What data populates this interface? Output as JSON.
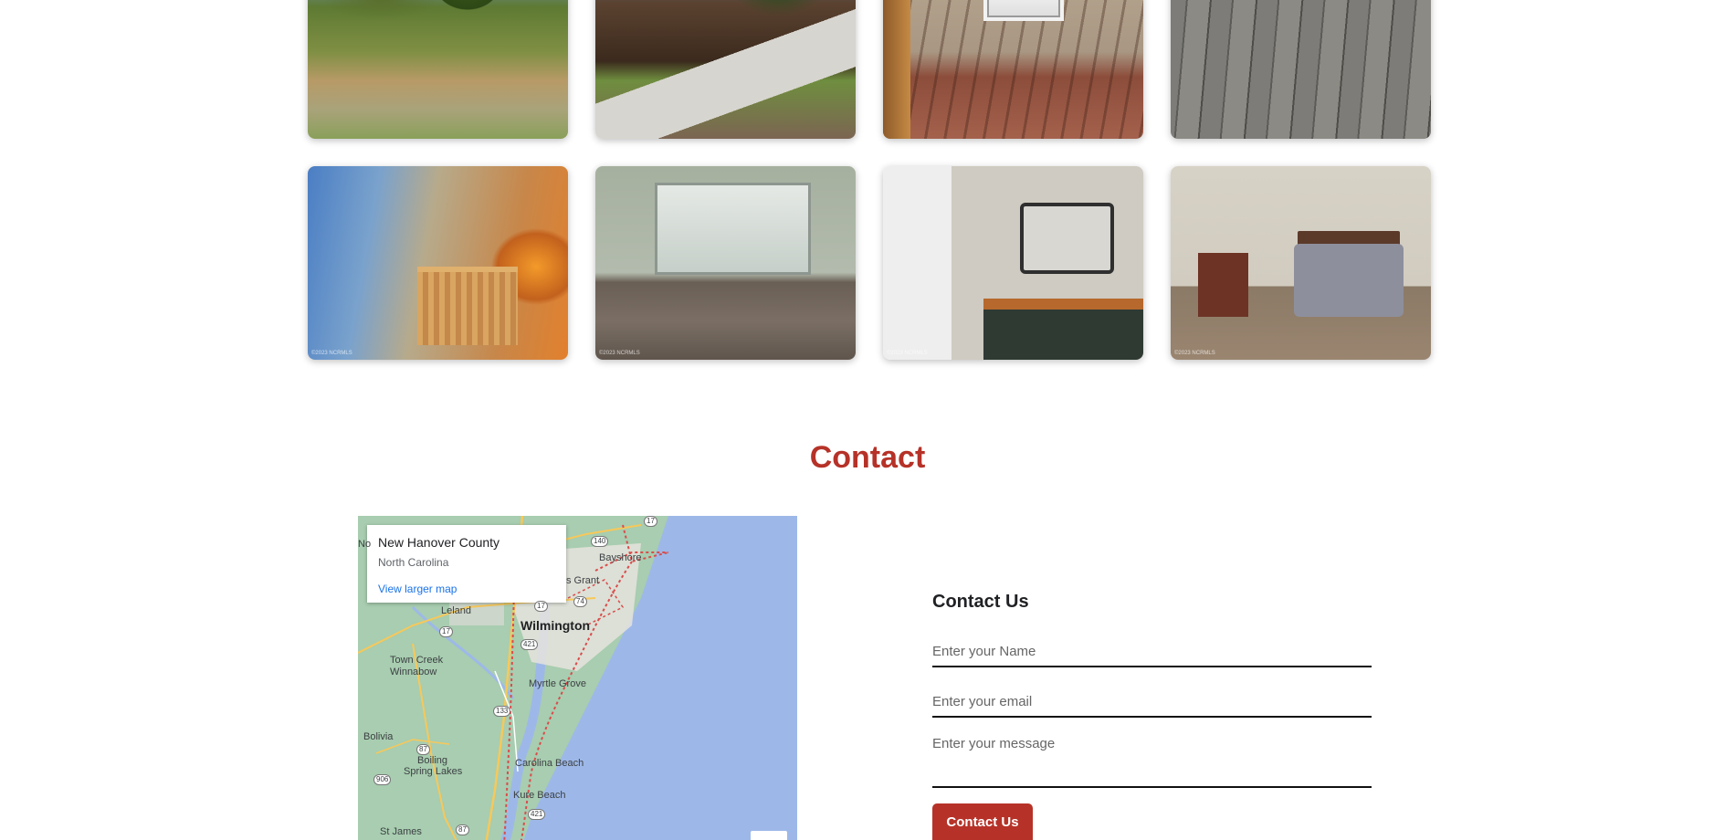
{
  "gallery": {
    "watermark": "©2023 NCRMLS"
  },
  "contact": {
    "section_title": "Contact",
    "form": {
      "title": "Contact Us",
      "name_placeholder": "Enter your Name",
      "email_placeholder": "Enter your email",
      "message_placeholder": "Enter your message",
      "submit_label": "Contact Us"
    },
    "map": {
      "card_name": "New Hanover County",
      "card_state": "North Carolina",
      "card_link": "View larger map",
      "labels": {
        "wilmington": "Wilmington",
        "bayshore": "Bayshore",
        "grant": "s Grant",
        "leland": "Leland",
        "town_creek": "Town Creek",
        "winnabow": "Winnabow",
        "myrtle_grove": "Myrtle Grove",
        "bolivia": "Bolivia",
        "boiling": "Boiling",
        "spring_lakes": "Spring Lakes",
        "carolina_beach": "Carolina Beach",
        "kure_beach": "Kure Beach",
        "st_james": "St James",
        "no": "No"
      },
      "shields": {
        "s17a": "17",
        "s140": "140",
        "s17b": "17",
        "s74": "74",
        "s17c": "17",
        "s421a": "421",
        "s133": "133",
        "s87a": "87",
        "s906": "906",
        "s421b": "421",
        "s87b": "87"
      }
    }
  }
}
